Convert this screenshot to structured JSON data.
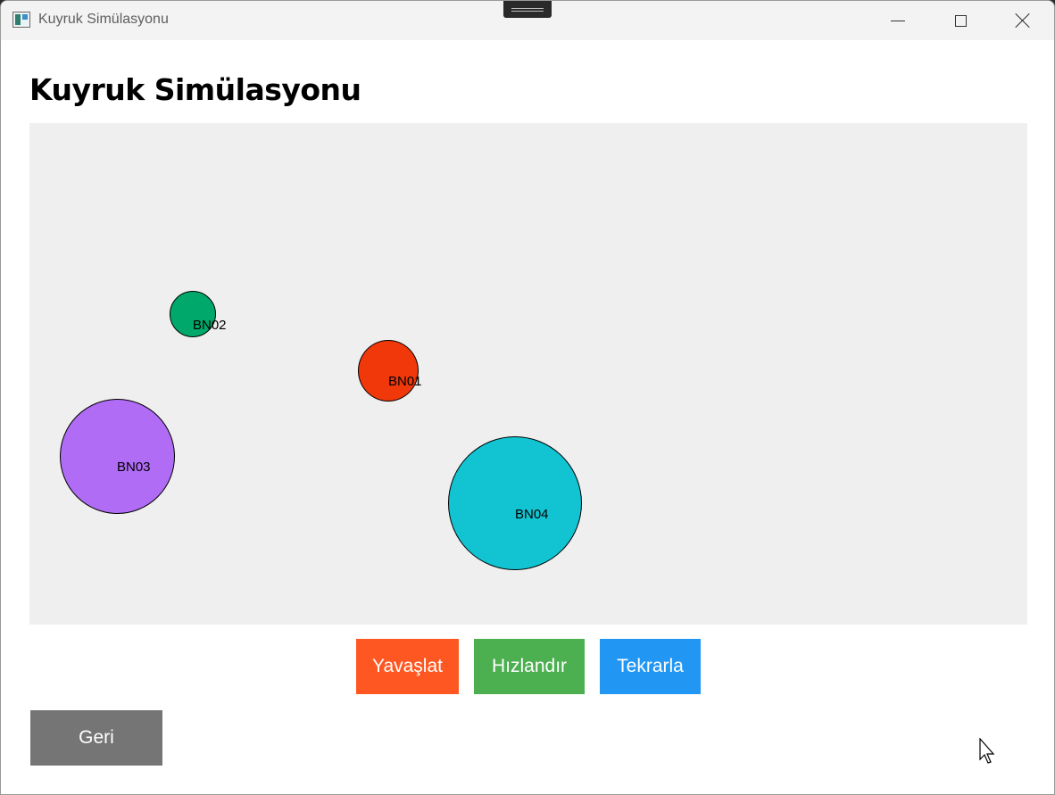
{
  "window": {
    "title": "Kuyruk Simülasyonu",
    "controls": {
      "minimize": "minimize-icon",
      "maximize": "maximize-icon",
      "close": "close-icon"
    }
  },
  "page": {
    "heading": "Kuyruk Simülasyonu"
  },
  "simulation": {
    "background": "#efefef",
    "balls": [
      {
        "label": "BN02",
        "color": "#00a86b"
      },
      {
        "label": "BN01",
        "color": "#f0380a"
      },
      {
        "label": "BN03",
        "color": "#b06cf5"
      },
      {
        "label": "BN04",
        "color": "#12c4d2"
      }
    ]
  },
  "controls": {
    "slow_label": "Yavaşlat",
    "fast_label": "Hızlandır",
    "repeat_label": "Tekrarla",
    "back_label": "Geri",
    "colors": {
      "slow": "#ff5722",
      "fast": "#4caf50",
      "repeat": "#2196f3",
      "back": "#757575"
    }
  }
}
